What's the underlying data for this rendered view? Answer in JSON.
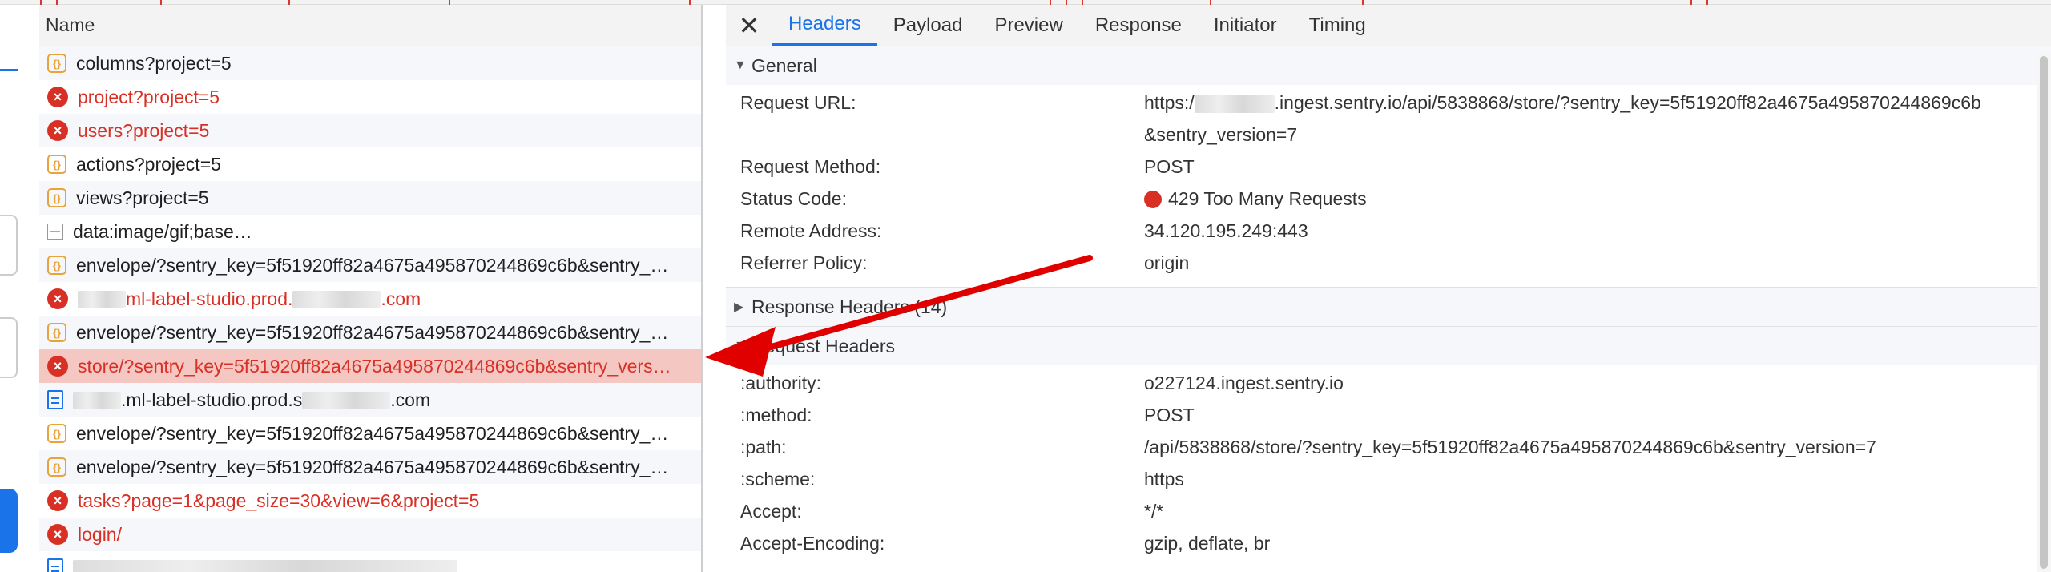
{
  "network": {
    "column_header": "Name",
    "rows": [
      {
        "icon": "json-icon",
        "text": "columns?project=5",
        "status": "ok"
      },
      {
        "icon": "error-icon",
        "text": "project?project=5",
        "status": "error"
      },
      {
        "icon": "error-icon",
        "text": "users?project=5",
        "status": "error"
      },
      {
        "icon": "json-icon",
        "text": "actions?project=5",
        "status": "ok"
      },
      {
        "icon": "json-icon",
        "text": "views?project=5",
        "status": "ok"
      },
      {
        "icon": "image-icon",
        "text": "data:image/gif;base…",
        "status": "ok"
      },
      {
        "icon": "json-icon",
        "text": "envelope/?sentry_key=5f51920ff82a4675a495870244869c6b&sentry_…",
        "status": "ok"
      },
      {
        "icon": "error-icon",
        "text": "ml-label-studio.prod.",
        "suffix": ".com",
        "status": "error",
        "blurred": true
      },
      {
        "icon": "json-icon",
        "text": "envelope/?sentry_key=5f51920ff82a4675a495870244869c6b&sentry_…",
        "status": "ok"
      },
      {
        "icon": "error-icon",
        "text": "store/?sentry_key=5f51920ff82a4675a495870244869c6b&sentry_vers…",
        "status": "error",
        "selected": true
      },
      {
        "icon": "document-icon",
        "text": ".ml-label-studio.prod.s",
        "suffix": ".com",
        "status": "ok",
        "blurred": true
      },
      {
        "icon": "json-icon",
        "text": "envelope/?sentry_key=5f51920ff82a4675a495870244869c6b&sentry_…",
        "status": "ok"
      },
      {
        "icon": "json-icon",
        "text": "envelope/?sentry_key=5f51920ff82a4675a495870244869c6b&sentry_…",
        "status": "ok"
      },
      {
        "icon": "error-icon",
        "text": "tasks?page=1&page_size=30&view=6&project=5",
        "status": "error"
      },
      {
        "icon": "error-icon",
        "text": "login/",
        "status": "error"
      },
      {
        "icon": "document-icon",
        "text": "",
        "status": "ok",
        "blurred_only": true
      }
    ]
  },
  "details": {
    "close_glyph": "✕",
    "tabs": [
      "Headers",
      "Payload",
      "Preview",
      "Response",
      "Initiator",
      "Timing"
    ],
    "active_tab": "Headers",
    "general": {
      "title": "General",
      "request_url_label": "Request URL:",
      "request_url_prefix": "https:/",
      "request_url_line1": ".ingest.sentry.io/api/5838868/store/?sentry_key=5f51920ff82a4675a495870244869c6b",
      "request_url_line2": "&sentry_version=7",
      "fields": [
        {
          "label": "Request Method:",
          "value": "POST"
        },
        {
          "label": "Status Code:",
          "value": "429 Too Many Requests",
          "status_dot": true
        },
        {
          "label": "Remote Address:",
          "value": "34.120.195.249:443"
        },
        {
          "label": "Referrer Policy:",
          "value": "origin"
        }
      ]
    },
    "response_headers": {
      "title": "Response Headers (14)"
    },
    "request_headers": {
      "title": "Request Headers",
      "fields": [
        {
          "label": ":authority:",
          "value": "o227124.ingest.sentry.io"
        },
        {
          "label": ":method:",
          "value": "POST"
        },
        {
          "label": ":path:",
          "value": "/api/5838868/store/?sentry_key=5f51920ff82a4675a495870244869c6b&sentry_version=7"
        },
        {
          "label": ":scheme:",
          "value": "https"
        },
        {
          "label": "Accept:",
          "value": "*/*"
        },
        {
          "label": "Accept-Encoding:",
          "value": "gzip, deflate, br"
        }
      ]
    }
  },
  "colors": {
    "accent": "#1a73e8",
    "error": "#d93025",
    "selected_row": "#f4c7c3",
    "arrow": "#e00000"
  }
}
